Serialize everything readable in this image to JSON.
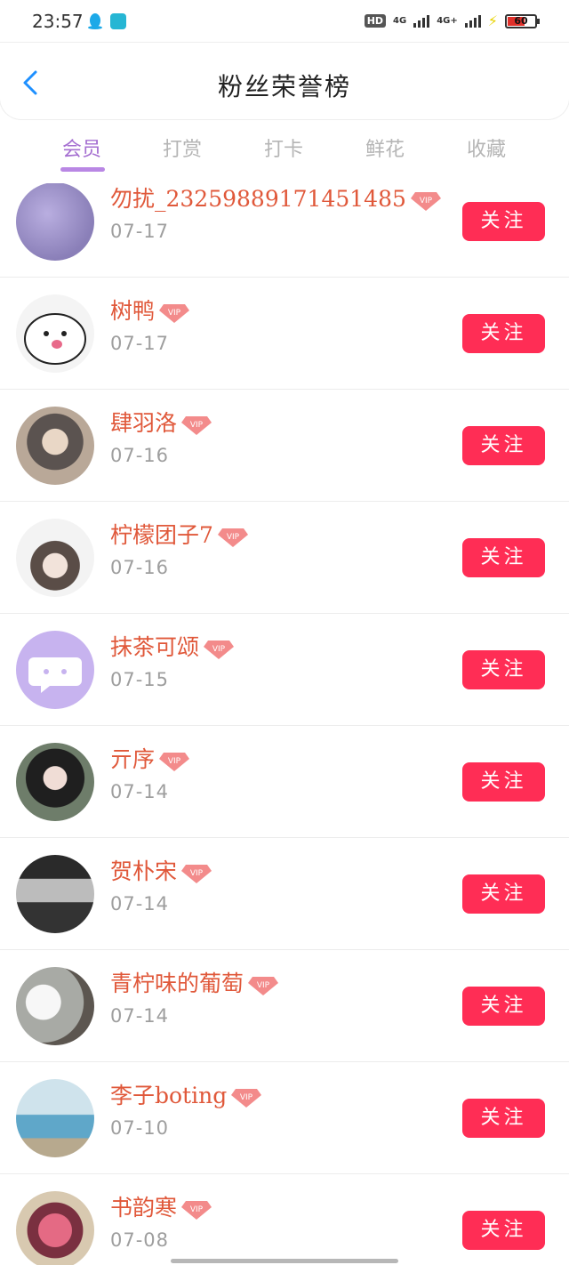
{
  "status": {
    "time": "23:57",
    "hd": "HD",
    "sim1": "4G",
    "sim2": "4G+",
    "battery": "60"
  },
  "header": {
    "title": "粉丝荣誉榜"
  },
  "tabs": [
    {
      "label": "会员",
      "active": true
    },
    {
      "label": "打赏",
      "active": false
    },
    {
      "label": "打卡",
      "active": false
    },
    {
      "label": "鲜花",
      "active": false
    },
    {
      "label": "收藏",
      "active": false
    }
  ],
  "rows": [
    {
      "name": "勿扰_2325988917145148​5",
      "date": "07-17",
      "follow": "关注",
      "avatar_color": "#8a7fb8"
    },
    {
      "name": "树鸭",
      "date": "07-17",
      "follow": "关注",
      "avatar_color": "#f2f2f2"
    },
    {
      "name": "肆羽洛",
      "date": "07-16",
      "follow": "关注",
      "avatar_color": "#8a7c6e"
    },
    {
      "name": "柠檬团子7",
      "date": "07-16",
      "follow": "关注",
      "avatar_color": "#e6e6e6"
    },
    {
      "name": "抹茶可颂",
      "date": "07-15",
      "follow": "关注",
      "avatar_color": "#c7b3ef"
    },
    {
      "name": "亓序",
      "date": "07-14",
      "follow": "关注",
      "avatar_color": "#3c3c3c"
    },
    {
      "name": "贺朴宋",
      "date": "07-14",
      "follow": "关注",
      "avatar_color": "#555555"
    },
    {
      "name": "青柠味的葡萄",
      "date": "07-14",
      "follow": "关注",
      "avatar_color": "#9da3a0"
    },
    {
      "name": "李子boting",
      "date": "07-10",
      "follow": "关注",
      "avatar_color": "#8fc3dc"
    },
    {
      "name": "书韵寒",
      "date": "07-08",
      "follow": "关注",
      "avatar_color": "#b25a6a"
    }
  ],
  "vip_label": "VIP",
  "colors": {
    "accent_tab": "#a56fd1",
    "follow_button": "#ff2d55",
    "name_text": "#e0583a",
    "back_icon": "#1e90ff"
  }
}
